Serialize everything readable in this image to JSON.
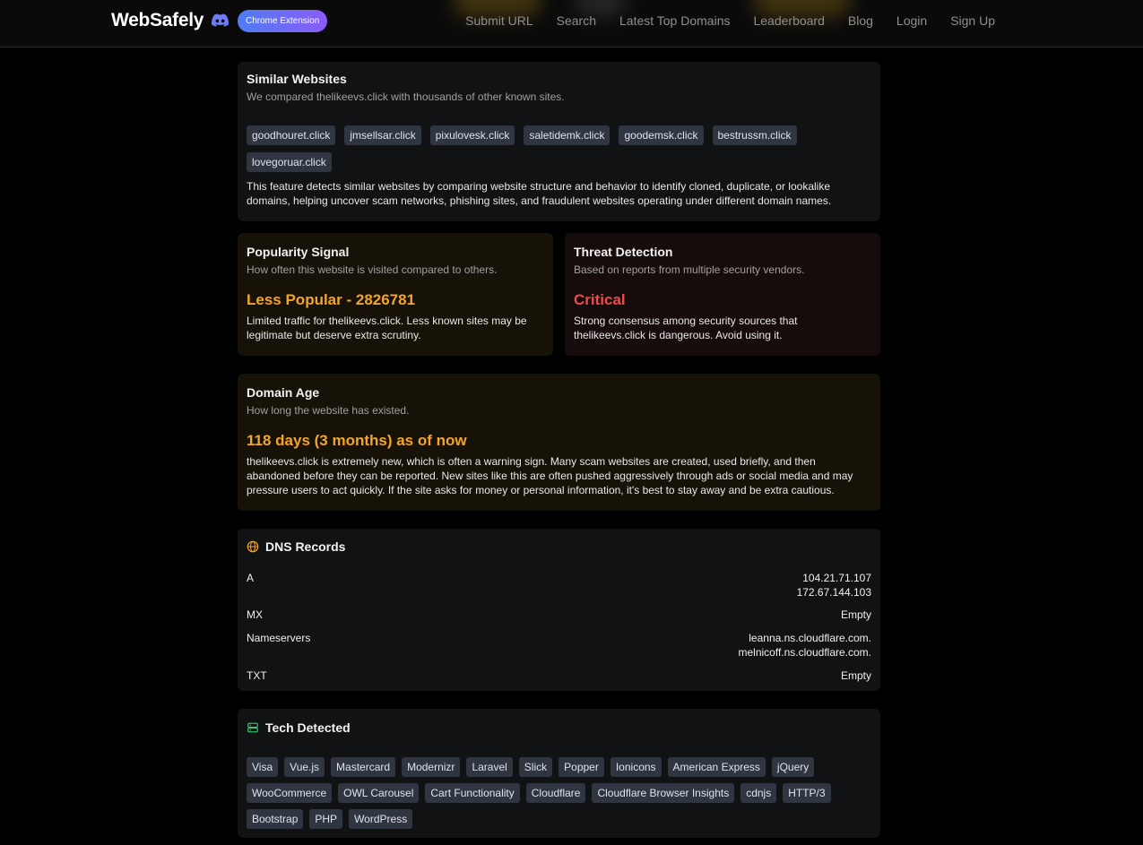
{
  "header": {
    "logo": "WebSafely",
    "extension_badge": "Chrome Extension",
    "nav": [
      "Submit URL",
      "Search",
      "Latest Top Domains",
      "Leaderboard",
      "Blog",
      "Login",
      "Sign Up"
    ],
    "colors": {
      "badge_start": "#4f7cf5",
      "badge_end": "#8a5cf6"
    }
  },
  "similar": {
    "title": "Similar Websites",
    "subtitle": "We compared thelikeevs.click with thousands of other known sites.",
    "sites": [
      "goodhouret.click",
      "jmsellsar.click",
      "pixulovesk.click",
      "saletidemk.click",
      "goodemsk.click",
      "bestrussm.click",
      "lovegoruar.click"
    ],
    "description": "This feature detects similar websites by comparing website structure and behavior to identify cloned, duplicate, or lookalike domains, helping uncover scam networks, phishing sites, and fraudulent websites operating under different domain names."
  },
  "popularity": {
    "title": "Popularity Signal",
    "subtitle": "How often this website is visited compared to others.",
    "value": "Less Popular - 2826781",
    "description": "Limited traffic for thelikeevs.click. Less known sites may be legitimate but deserve extra scrutiny.",
    "accent": "#f5a524"
  },
  "threat": {
    "title": "Threat Detection",
    "subtitle": "Based on reports from multiple security vendors.",
    "value": "Critical",
    "description": "Strong consensus among security sources that thelikeevs.click is dangerous. Avoid using it.",
    "accent": "#ef4a4a"
  },
  "domain_age": {
    "title": "Domain Age",
    "subtitle": "How long the website has existed.",
    "value": "118 days (3 months) as of now",
    "description": "thelikeevs.click is extremely new, which is often a warning sign. Many scam websites are created, used briefly, and then abandoned before they can be reported. New sites like this are often pushed aggressively through ads or social media and may pressure users to act quickly. If the site asks for money or personal information, it's best to stay away and be extra cautious."
  },
  "dns": {
    "title": "DNS Records",
    "icon": "globe-icon",
    "records": [
      {
        "type": "A",
        "values": [
          "104.21.71.107",
          "172.67.144.103"
        ]
      },
      {
        "type": "MX",
        "values": [
          "Empty"
        ]
      },
      {
        "type": "Nameservers",
        "values": [
          "leanna.ns.cloudflare.com.",
          "melnicoff.ns.cloudflare.com."
        ]
      },
      {
        "type": "TXT",
        "values": [
          "Empty"
        ]
      }
    ]
  },
  "tech": {
    "title": "Tech Detected",
    "icon": "server-icon",
    "items": [
      "Visa",
      "Vue.js",
      "Mastercard",
      "Modernizr",
      "Laravel",
      "Slick",
      "Popper",
      "Ionicons",
      "American Express",
      "jQuery",
      "WooCommerce",
      "OWL Carousel",
      "Cart Functionality",
      "Cloudflare",
      "Cloudflare Browser Insights",
      "cdnjs",
      "HTTP/3",
      "Bootstrap",
      "PHP",
      "WordPress"
    ]
  }
}
